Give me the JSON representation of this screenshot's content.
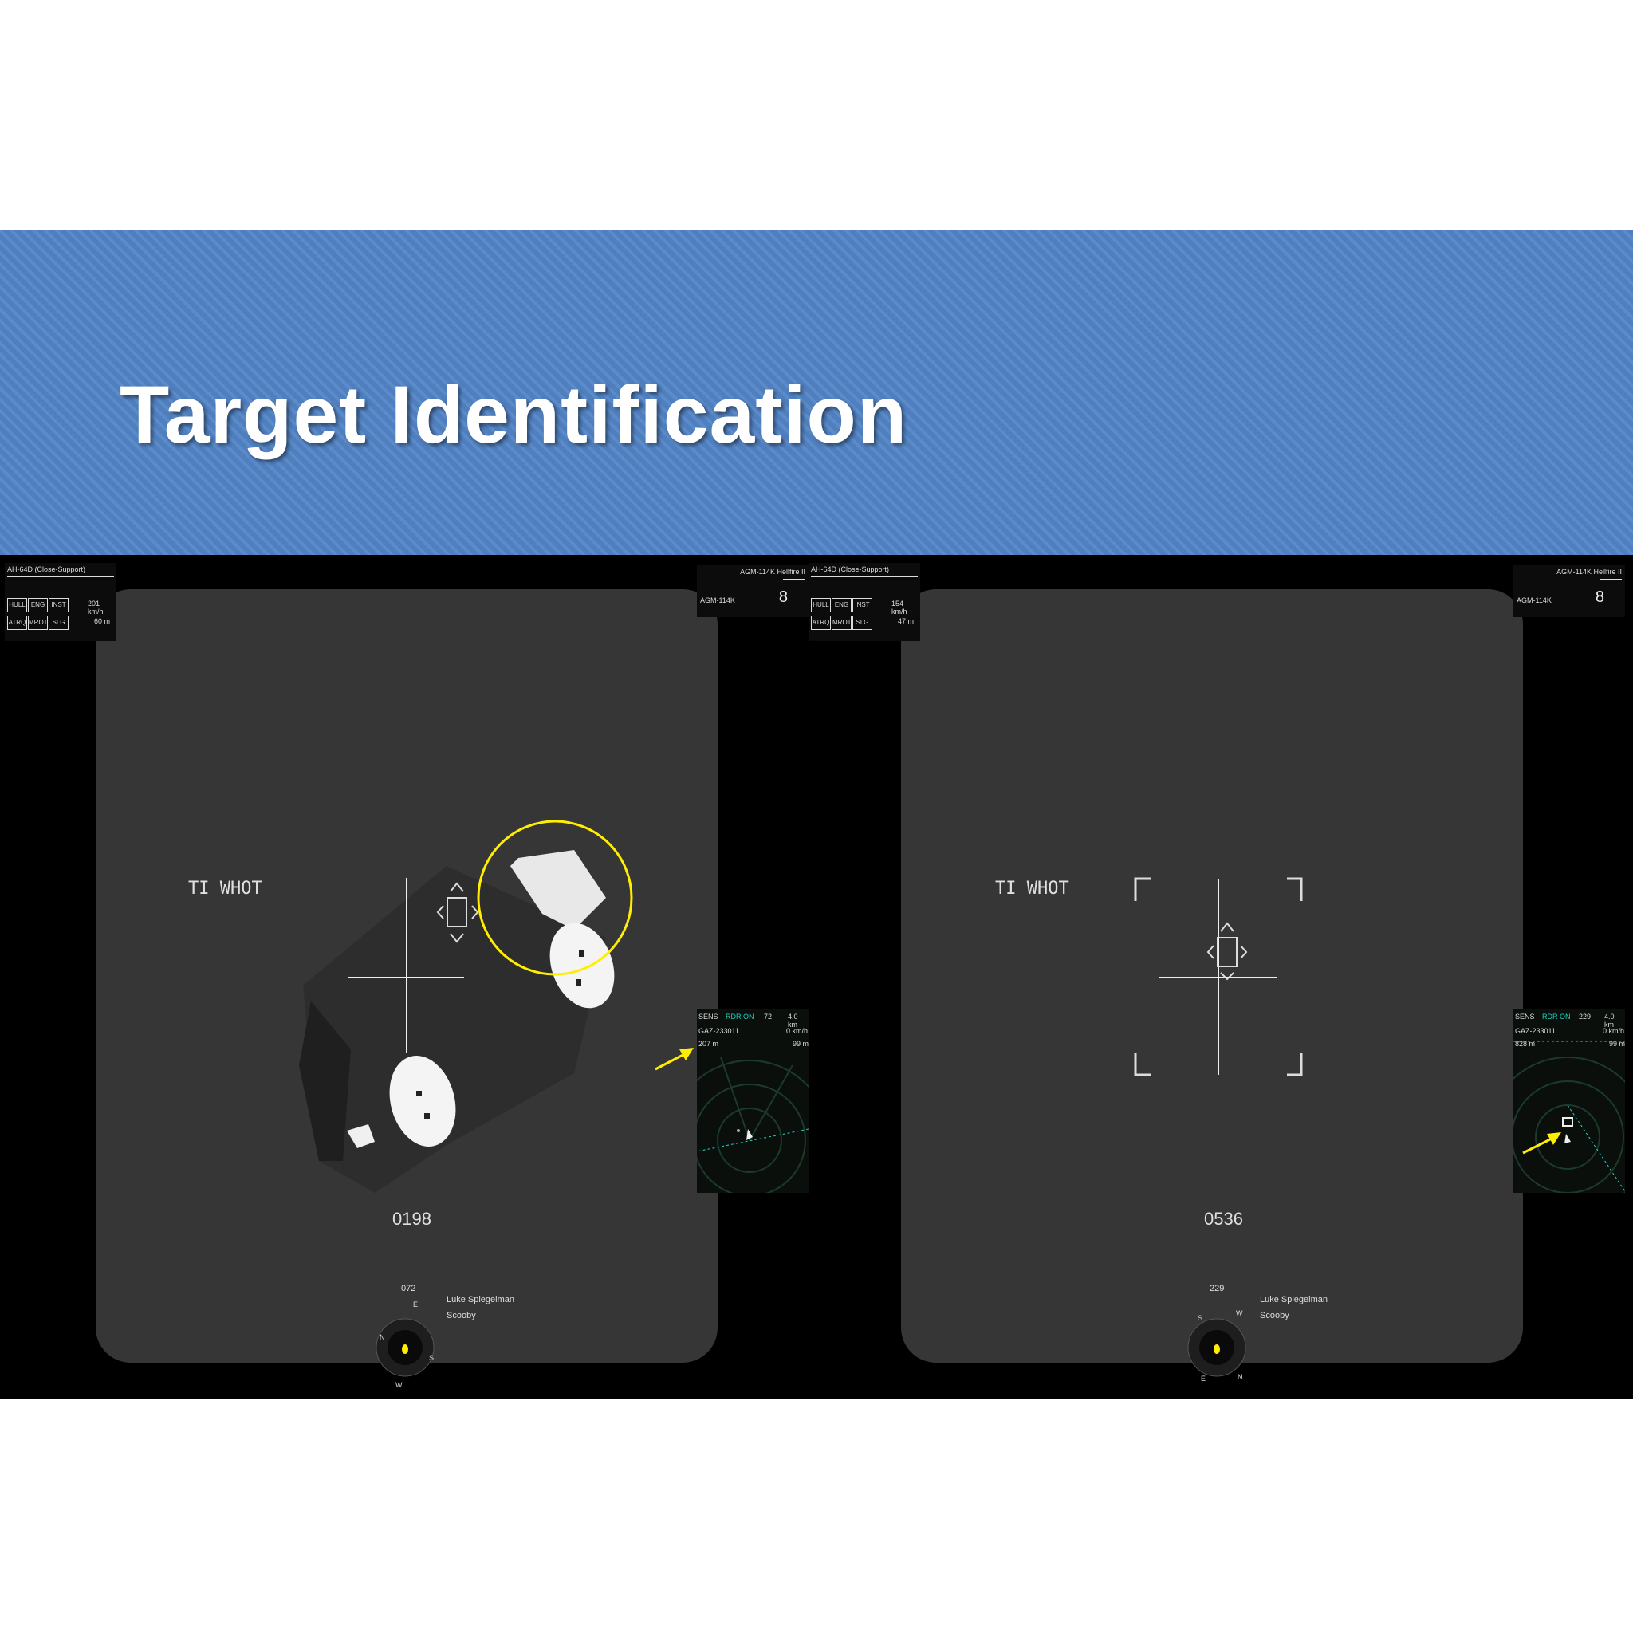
{
  "slide": {
    "title": "Target Identification"
  },
  "panels": [
    {
      "status": {
        "header": "AH-64D (Close-Support)",
        "chips": [
          "HULL",
          "ENG",
          "INST",
          "ATRQ",
          "MROT",
          "SLG"
        ],
        "speed": "201 km/h",
        "altitude": "60 m"
      },
      "weapon": {
        "name": "AGM-114K Hellfire II",
        "type": "AGM-114K",
        "count": "8"
      },
      "mode": "TI WHOT",
      "code": "0198",
      "heading": "072",
      "crew": [
        "Luke Spiegelman",
        "Scooby"
      ],
      "radar": {
        "sens": "SENS",
        "rdr": "RDR ON",
        "bearing": "72",
        "range_scale": "4.0 km",
        "target_id": "GAZ-233011",
        "target_dist": "207 m",
        "speed": "0 km/h",
        "alt": "99 m"
      }
    },
    {
      "status": {
        "header": "AH-64D (Close-Support)",
        "chips": [
          "HULL",
          "ENG",
          "INST",
          "ATRQ",
          "MROT",
          "SLG"
        ],
        "speed": "154 km/h",
        "altitude": "47 m"
      },
      "weapon": {
        "name": "AGM-114K Hellfire II",
        "type": "AGM-114K",
        "count": "8"
      },
      "mode": "TI WHOT",
      "code": "0536",
      "heading": "229",
      "crew": [
        "Luke Spiegelman",
        "Scooby"
      ],
      "radar": {
        "sens": "SENS",
        "rdr": "RDR ON",
        "bearing": "229",
        "range_scale": "4.0 km",
        "target_id": "GAZ-233011",
        "target_dist": "828 m",
        "speed": "0 km/h",
        "alt": "99 m"
      }
    }
  ],
  "colors": {
    "banner": "#4f7fbf",
    "highlight": "#ffee00",
    "radar_accent": "#1fd0c0"
  }
}
